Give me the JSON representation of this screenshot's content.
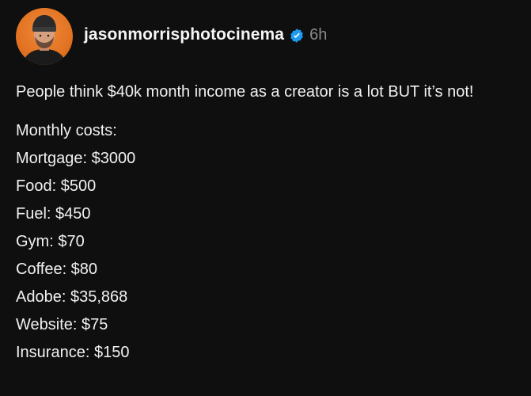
{
  "post": {
    "author": {
      "username": "jasonmorrisphotocinema",
      "verified": true,
      "avatar_icon": "avatar-photo"
    },
    "timestamp": "6h",
    "intro": "People think $40k month income as a creator is a lot BUT it’s not!",
    "costs_heading": "Monthly costs:",
    "costs": [
      "Mortgage: $3000",
      "Food: $500",
      "Fuel: $450",
      "Gym: $70",
      "Coffee: $80",
      "Adobe: $35,868",
      "Website: $75",
      "Insurance: $150"
    ]
  },
  "colors": {
    "background": "#0f0f0f",
    "text": "#f1f1f1",
    "muted": "#8b8b8b",
    "verified_blue": "#1d9bf0",
    "avatar_orange": "#e27322"
  }
}
